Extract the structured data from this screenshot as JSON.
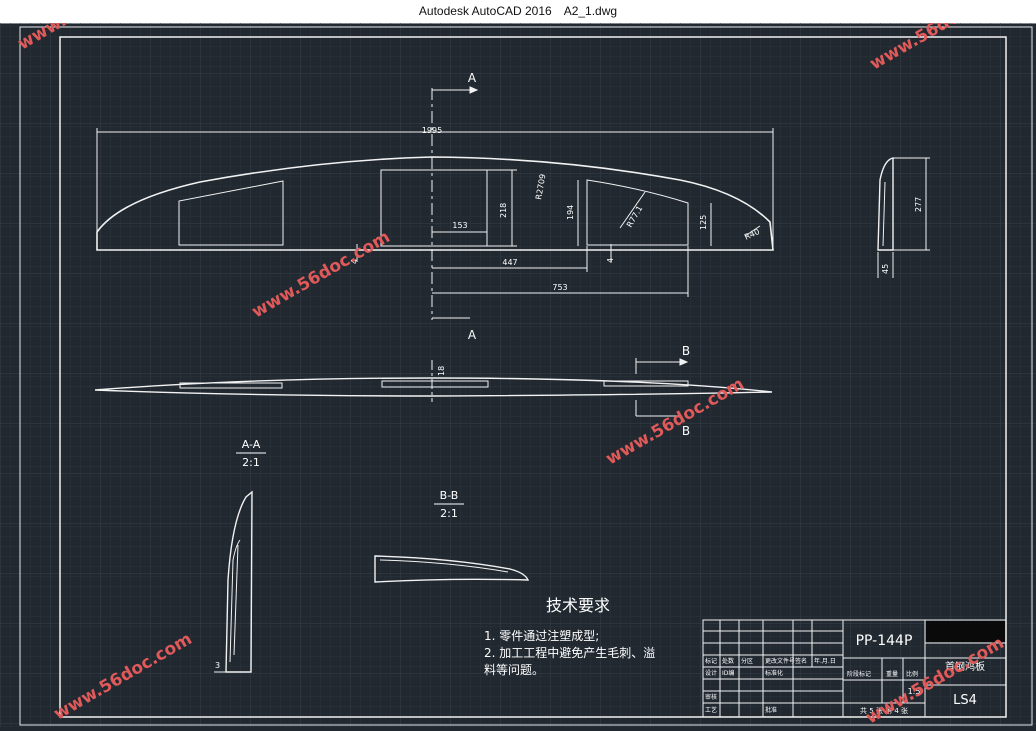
{
  "window": {
    "app_title": "Autodesk AutoCAD 2016",
    "file_name": "A2_1.dwg"
  },
  "section_labels": {
    "A_top": "A",
    "A_bottom": "A",
    "B_top": "B",
    "B_bottom": "B"
  },
  "dimensions": {
    "overall_length": "1995",
    "r2709": "R2709",
    "r7771": "R77.1",
    "d218": "218",
    "d194": "194",
    "d125": "125",
    "r40": "R40",
    "d153": "153",
    "d447": "447",
    "d753": "753",
    "d4_left": "4",
    "d4_right": "4",
    "side_277": "277",
    "side_45": "45",
    "d18": "18",
    "d3": "3"
  },
  "section_views": {
    "aa_title": "A-A",
    "aa_scale": "2:1",
    "bb_title": "B-B",
    "bb_scale": "2:1"
  },
  "tech_requirements": {
    "heading": "技术要求",
    "line1": "1. 零件通过注塑成型;",
    "line2": "2. 加工工程中避免产生毛刺、溢",
    "line3": "料等问题。"
  },
  "title_block": {
    "drawing_no": "PP-144P",
    "part_name": "首钢鸿板",
    "sheet": "LS4",
    "scale": "1:5",
    "r1": [
      "标记",
      "处数",
      "分区",
      "更改文件号",
      "签名",
      "年.月.日"
    ],
    "r2": [
      "设计",
      "ID编",
      "标准化"
    ],
    "r3": [
      "阶段标记",
      "重量",
      "比例"
    ],
    "r4": [
      "审核"
    ],
    "r5": [
      "工艺",
      "批准"
    ],
    "bottom_info": "共 5 张 第 4 张"
  },
  "watermark": "www.56doc.com"
}
